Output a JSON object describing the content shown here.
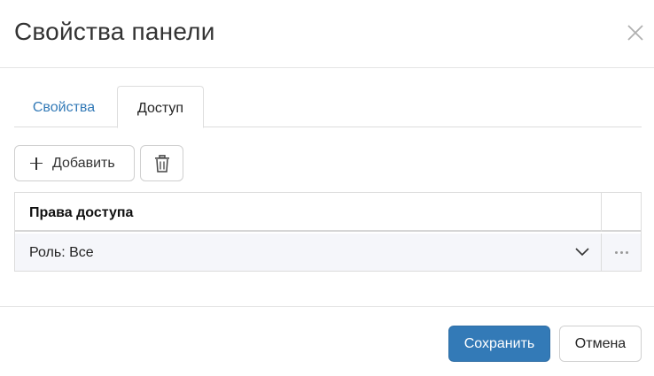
{
  "dialog": {
    "title": "Свойства панели"
  },
  "tabs": [
    {
      "label": "Свойства",
      "active": false
    },
    {
      "label": "Доступ",
      "active": true
    }
  ],
  "toolbar": {
    "add_label": "Добавить"
  },
  "grid": {
    "header": "Права доступа",
    "rows": [
      {
        "value": "Роль: Все"
      }
    ]
  },
  "footer": {
    "save_label": "Сохранить",
    "cancel_label": "Отмена"
  },
  "colors": {
    "primary": "#337ab7",
    "tab_link": "#337ab7",
    "row_background": "#f5f6fa"
  }
}
